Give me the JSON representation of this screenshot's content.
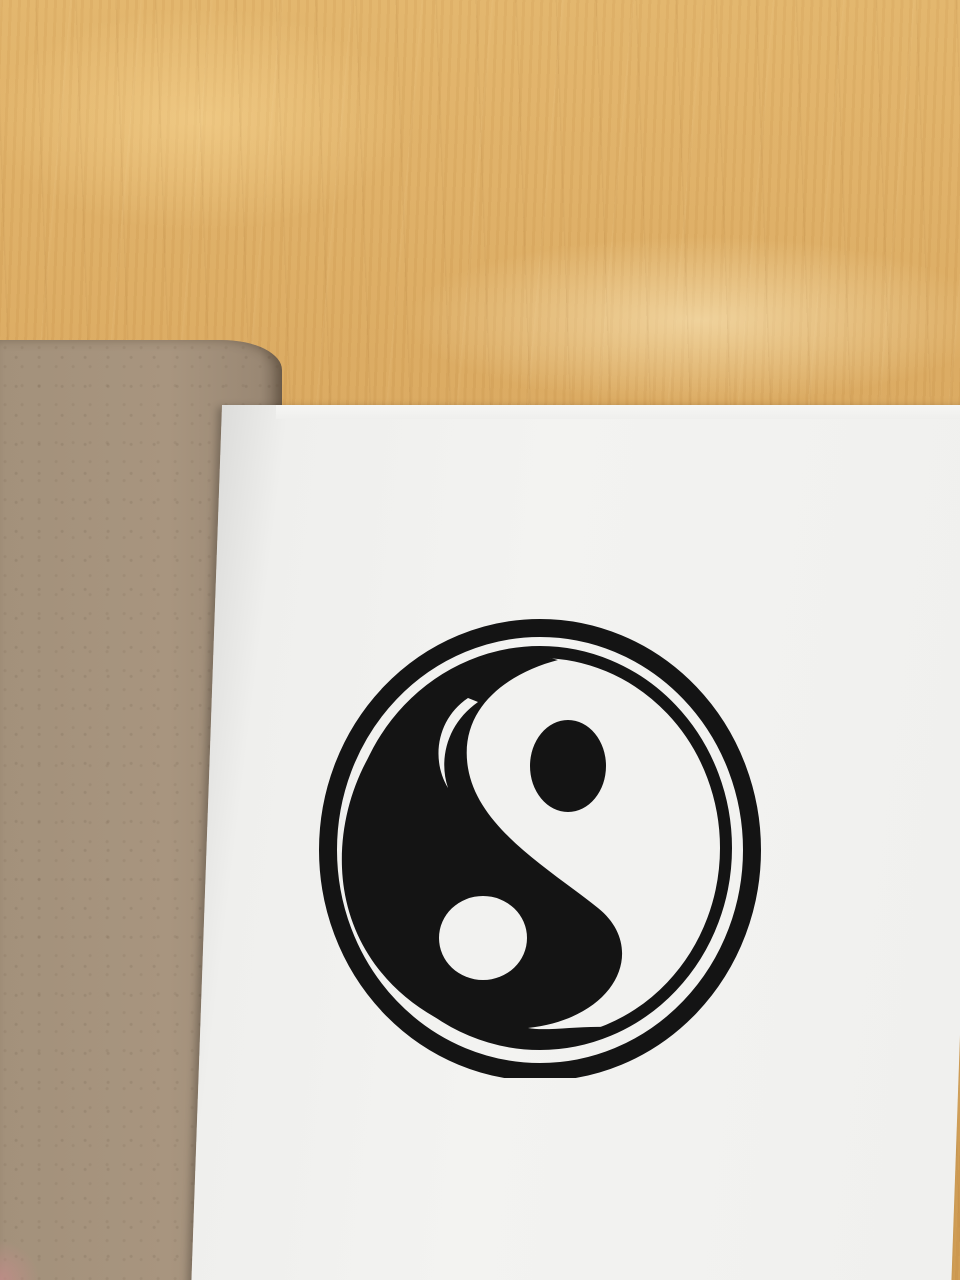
{
  "scene": {
    "subject": "yin-yang-drawing",
    "surface": "wooden-table",
    "booklet": {
      "left_page": "kraft-paper",
      "right_page": "white-paper"
    }
  },
  "colors": {
    "wood": "#d7a55c",
    "kraft": "#a3917b",
    "paper": "#f0f0ee",
    "ink": "#141414"
  }
}
